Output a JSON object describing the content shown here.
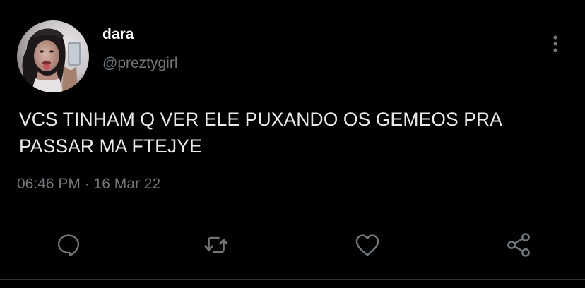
{
  "tweet": {
    "display_name": "dara",
    "handle": "@preztygirl",
    "text": "VCS TINHAM Q VER ELE PUXANDO OS GEMEOS PRA PASSAR MA FTEJYE",
    "time": "06:46 PM",
    "separator": "·",
    "date": "16 Mar 22"
  },
  "colors": {
    "background": "#000000",
    "text_primary": "#e7e9ea",
    "text_secondary": "#71767b",
    "divider": "#2f3336",
    "icon": "#71767b"
  },
  "icons": {
    "more": "more-vertical-icon",
    "reply": "reply-icon",
    "retweet": "retweet-icon",
    "like": "heart-icon",
    "share": "share-icon"
  }
}
